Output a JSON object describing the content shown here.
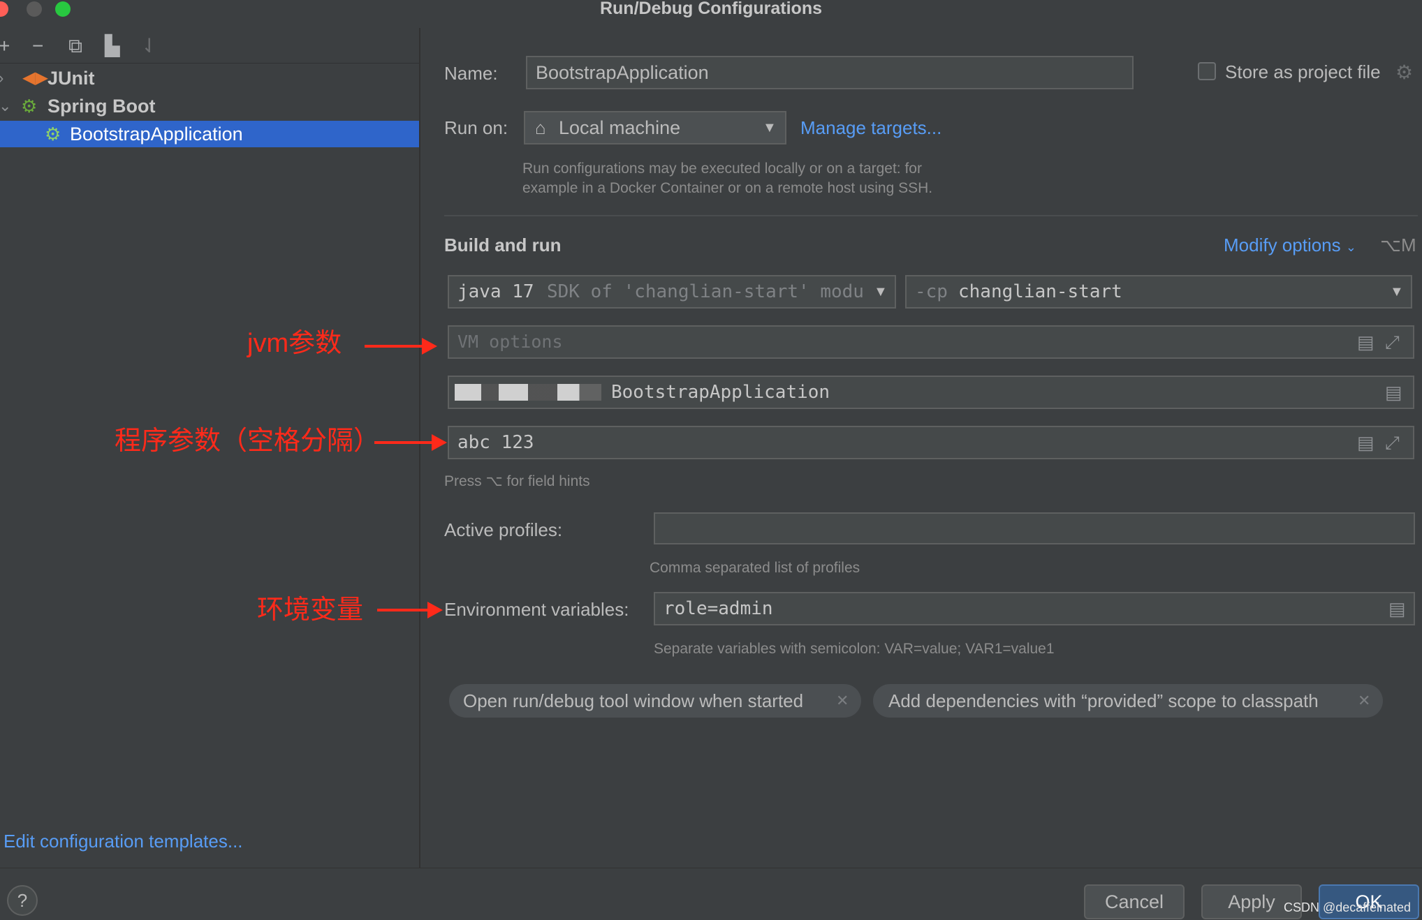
{
  "window": {
    "title": "Run/Debug Configurations"
  },
  "tree": {
    "items": [
      {
        "label": "JUnit"
      },
      {
        "label": "Spring Boot"
      },
      {
        "label": "BootstrapApplication"
      }
    ],
    "edit_templates": "Edit configuration templates..."
  },
  "form": {
    "name_label": "Name:",
    "name_value": "BootstrapApplication",
    "store_label": "Store as project file",
    "runon_label": "Run on:",
    "runon_value": "Local machine",
    "manage_targets": "Manage targets...",
    "runon_hint_1": "Run configurations may be executed locally or on a target: for",
    "runon_hint_2": "example in a Docker Container or on a remote host using SSH.",
    "section_title": "Build and run",
    "modify_options": "Modify options",
    "modify_shortcut": "⌥M",
    "sdk_main": "java 17",
    "sdk_detail": "SDK of 'changlian-start' modu",
    "cp_prefix": "-cp",
    "cp_value": "changlian-start",
    "vm_placeholder": "VM options",
    "main_class": "BootstrapApplication",
    "program_args": "abc 123",
    "field_hint": "Press ⌥ for field hints",
    "profiles_label": "Active profiles:",
    "profiles_value": "",
    "profiles_hint": "Comma separated list of profiles",
    "env_label": "Environment variables:",
    "env_value": "role=admin",
    "env_hint": "Separate variables with semicolon: VAR=value; VAR1=value1",
    "chips": [
      {
        "label": "Open run/debug tool window when started"
      },
      {
        "label": "Add dependencies with “provided” scope to classpath"
      }
    ]
  },
  "buttons": {
    "cancel": "Cancel",
    "apply": "Apply",
    "ok": "OK",
    "help": "?"
  },
  "annotations": {
    "jvm": "jvm参数",
    "program": "程序参数（空格分隔）",
    "env": "环境变量"
  },
  "watermark": "CSDN @decaffeinated",
  "colors": {
    "accent": "#589df6",
    "selection": "#2f65ca",
    "annotation": "#ff2a1a",
    "background": "#3c3f41"
  }
}
